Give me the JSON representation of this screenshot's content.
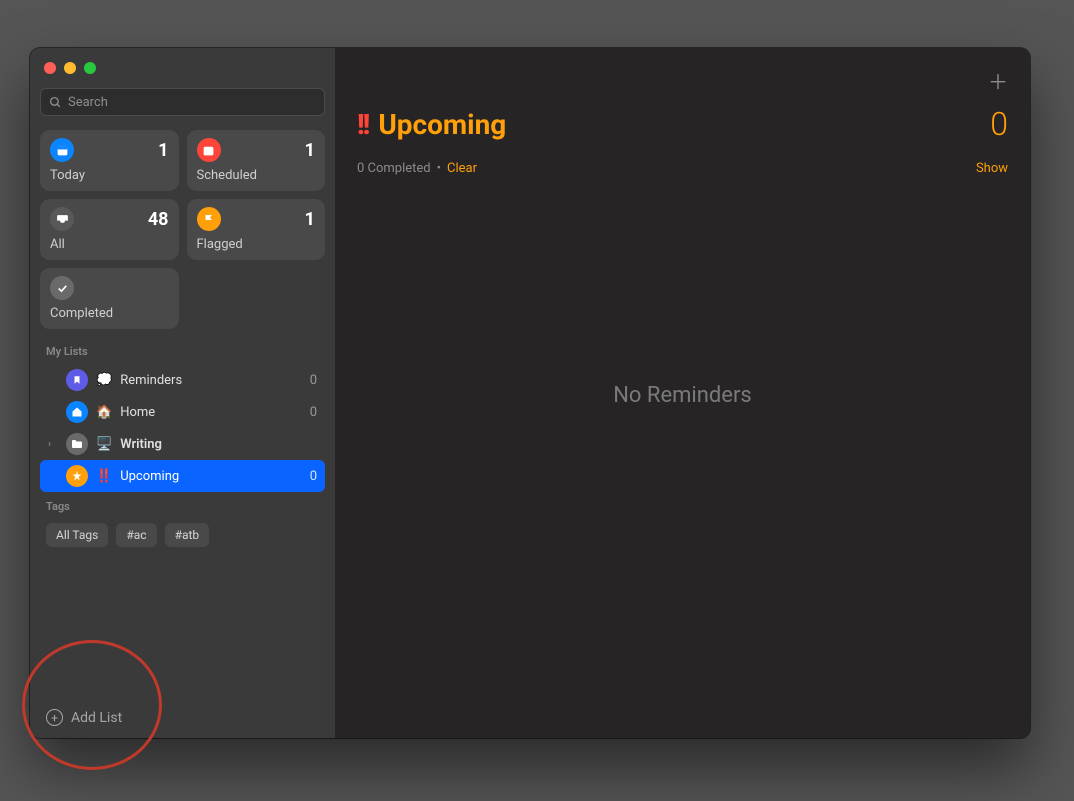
{
  "search": {
    "placeholder": "Search"
  },
  "smart": {
    "today": {
      "label": "Today",
      "count": "1"
    },
    "scheduled": {
      "label": "Scheduled",
      "count": "1"
    },
    "all": {
      "label": "All",
      "count": "48"
    },
    "flagged": {
      "label": "Flagged",
      "count": "1"
    },
    "completed": {
      "label": "Completed",
      "count": ""
    }
  },
  "myListsHeader": "My Lists",
  "lists": {
    "reminders": {
      "emoji": "💭",
      "name": "Reminders",
      "count": "0"
    },
    "home": {
      "emoji": "🏠",
      "name": "Home",
      "count": "0"
    },
    "writing": {
      "emoji": "🖥️",
      "name": "Writing",
      "count": ""
    },
    "upcoming": {
      "prefix": "‼️",
      "name": "Upcoming",
      "count": "0"
    }
  },
  "tagsHeader": "Tags",
  "tags": {
    "all": "All Tags",
    "t1": "#ac",
    "t2": "#atb"
  },
  "addList": "Add List",
  "main": {
    "bangs": "!!",
    "title": "Upcoming",
    "bigCount": "0",
    "completedText": "0 Completed",
    "dot": "•",
    "clear": "Clear",
    "show": "Show",
    "empty": "No Reminders"
  }
}
